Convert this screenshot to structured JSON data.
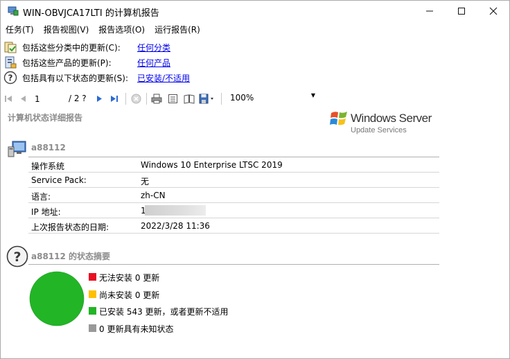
{
  "window": {
    "title": "WIN-OBVJCA17LTI 的计算机报告",
    "min_glyph": "—",
    "max_glyph": "☐",
    "close_glyph": "✕"
  },
  "menu": [
    "任务(T)",
    "报告视图(V)",
    "报告选项(O)",
    "运行报告(R)"
  ],
  "filters": [
    {
      "icon": "classification-icon",
      "label": "包括这些分类中的更新(C):",
      "link": "任何分类"
    },
    {
      "icon": "product-icon",
      "label": "包括这些产品的更新(P):",
      "link": "任何产品"
    },
    {
      "icon": "status-question-icon",
      "label": "包括具有以下状态的更新(S):",
      "link": "已安装/不适用"
    }
  ],
  "toolbar": {
    "page_current": "1",
    "page_total": "/ 2 ?",
    "zoom": "100%"
  },
  "report": {
    "title": "计算机状态详细报告",
    "logo_name": "Windows Server",
    "logo_sub": "Update Services",
    "computer_name": "a88112",
    "details": [
      {
        "label": "操作系统",
        "value": "Windows 10 Enterprise LTSC 2019"
      },
      {
        "label": "Service Pack:",
        "value": "无"
      },
      {
        "label": "语言:",
        "value": "zh-CN"
      },
      {
        "label": "IP 地址:",
        "value": "1"
      },
      {
        "label": "上次报告状态的日期:",
        "value": "2022/3/28 11:36"
      }
    ],
    "summary_title": "a88112 的状态摘要"
  },
  "colors": {
    "failed": "#e81123",
    "needed": "#ffc000",
    "installed": "#22b526",
    "unknown": "#999999",
    "link": "#0000ee"
  },
  "chart_data": {
    "type": "pie",
    "title": "a88112 的状态摘要",
    "categories": [
      "无法安装",
      "尚未安装",
      "已安装",
      "未知状态"
    ],
    "values": [
      0,
      0,
      543,
      0
    ],
    "colors": [
      "#e81123",
      "#ffc000",
      "#22b526",
      "#999999"
    ],
    "legend": [
      "无法安装 0 更新",
      "尚未安装 0 更新",
      "已安装 543 更新，或者更新不适用",
      "0 更新具有未知状态"
    ]
  }
}
